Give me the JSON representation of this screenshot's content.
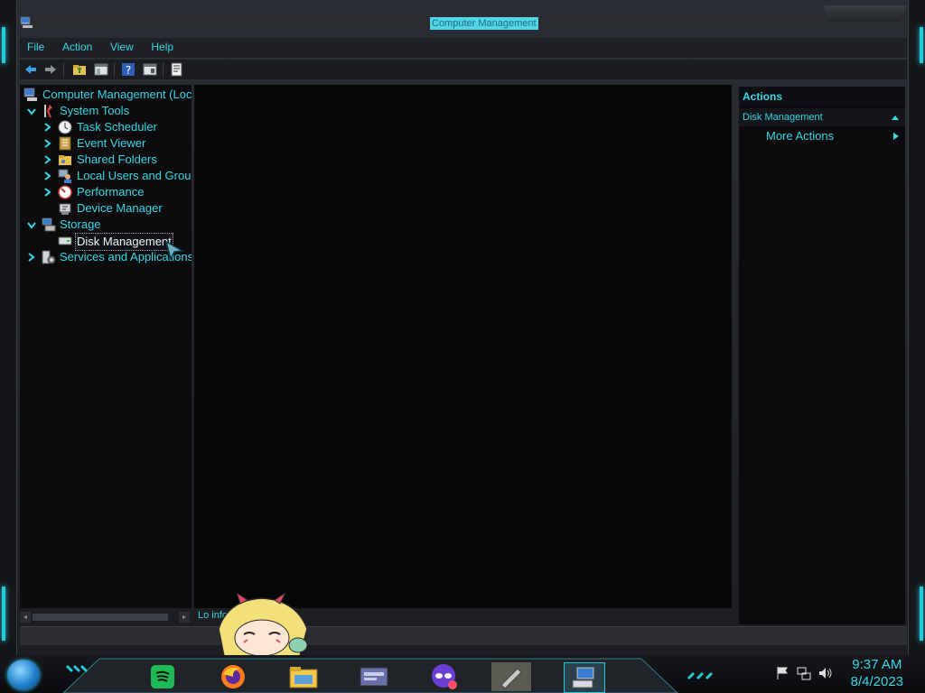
{
  "window": {
    "title": "Computer Management"
  },
  "menu": {
    "items": [
      "File",
      "Action",
      "View",
      "Help"
    ]
  },
  "toolbar": {
    "buttons": [
      "back-icon",
      "forward-icon",
      "up-folder-icon",
      "console-tree-icon",
      "help-icon",
      "properties-icon",
      "export-icon"
    ]
  },
  "tree": {
    "root": "Computer Management (Loc",
    "system_tools": "System Tools",
    "task_scheduler": "Task Scheduler",
    "event_viewer": "Event Viewer",
    "shared_folders": "Shared Folders",
    "local_users": "Local Users and Grou",
    "performance": "Performance",
    "device_manager": "Device Manager",
    "storage": "Storage",
    "disk_management": "Disk Management",
    "services": "Services and Applications"
  },
  "status": {
    "text": "Lo            information..."
  },
  "actions": {
    "header": "Actions",
    "group": "Disk Management",
    "more": "More Actions"
  },
  "taskbar": {
    "time": "9:37 AM",
    "date": "8/4/2023",
    "apps": [
      "spotify-icon",
      "firefox-icon",
      "file-explorer-icon",
      "control-panel-icon",
      "theme-app-icon",
      "tool-icon",
      "computer-management-icon"
    ]
  },
  "colors": {
    "accent": "#37d7e7",
    "background": "#0b0b0d"
  }
}
